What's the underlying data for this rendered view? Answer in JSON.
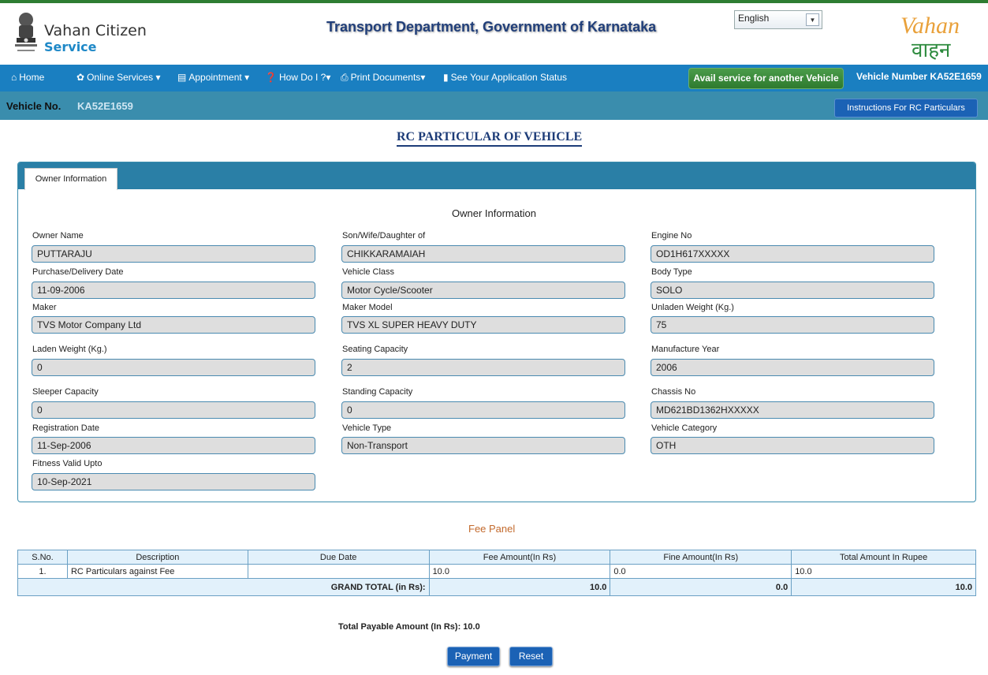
{
  "header": {
    "brand_line1": "Vahan Citizen",
    "brand_line2": "Service",
    "department_title": "Transport Department, Government of Karnataka",
    "language_selected": "English",
    "logo_text_latin": "Vahan",
    "logo_text_hindi": "वाहन"
  },
  "nav": {
    "home": "Home",
    "online_services": "Online Services",
    "appointment": "Appointment",
    "how_do_i": "How Do I ?",
    "print_documents": "Print Documents",
    "application_status": "See Your Application Status",
    "avail_service": "Avail service for another Vehicle",
    "vehicle_number_label": "Vehicle Number",
    "vehicle_number": "KA52E1659"
  },
  "vehicle_bar": {
    "label": "Vehicle No.",
    "value": "KA52E1659",
    "instructions_button": "Instructions For RC Particulars"
  },
  "page_heading": "RC PARTICULAR OF VEHICLE",
  "tabs": [
    "Owner Information"
  ],
  "owner_section_title": "Owner Information",
  "fields": {
    "owner_name": {
      "label": "Owner Name",
      "value": "PUTTARAJU"
    },
    "relation": {
      "label": "Son/Wife/Daughter of",
      "value": "CHIKKARAMAIAH"
    },
    "engine_no": {
      "label": "Engine No",
      "value": "OD1H617XXXXX"
    },
    "purchase_date": {
      "label": "Purchase/Delivery Date",
      "value": "11-09-2006"
    },
    "vehicle_class": {
      "label": "Vehicle Class",
      "value": "Motor Cycle/Scooter"
    },
    "body_type": {
      "label": "Body Type",
      "value": "SOLO"
    },
    "maker": {
      "label": "Maker",
      "value": "TVS Motor Company Ltd"
    },
    "maker_model": {
      "label": "Maker Model",
      "value": "TVS XL SUPER HEAVY DUTY"
    },
    "unladen_weight": {
      "label": "Unladen Weight (Kg.)",
      "value": "75"
    },
    "laden_weight": {
      "label": "Laden Weight (Kg.)",
      "value": "0"
    },
    "seating_capacity": {
      "label": "Seating Capacity",
      "value": "2"
    },
    "manufacture_year": {
      "label": "Manufacture Year",
      "value": "2006"
    },
    "sleeper_capacity": {
      "label": "Sleeper Capacity",
      "value": "0"
    },
    "standing_capacity": {
      "label": "Standing Capacity",
      "value": "0"
    },
    "chassis_no": {
      "label": "Chassis No",
      "value": "MD621BD1362HXXXXX"
    },
    "registration_date": {
      "label": "Registration Date",
      "value": "11-Sep-2006"
    },
    "vehicle_type": {
      "label": "Vehicle Type",
      "value": "Non-Transport"
    },
    "vehicle_category": {
      "label": "Vehicle Category",
      "value": "OTH"
    },
    "fitness_valid": {
      "label": "Fitness Valid Upto",
      "value": "10-Sep-2021"
    }
  },
  "fee_panel": {
    "title": "Fee Panel",
    "columns": [
      "S.No.",
      "Description",
      "Due Date",
      "Fee Amount(In Rs)",
      "Fine Amount(In Rs)",
      "Total Amount In Rupee"
    ],
    "rows": [
      {
        "sno": "1.",
        "description": "RC Particulars against Fee",
        "due_date": "",
        "fee": "10.0",
        "fine": "0.0",
        "total": "10.0"
      }
    ],
    "grand_total_label": "GRAND TOTAL (in Rs):",
    "grand_fee": "10.0",
    "grand_fine": "0.0",
    "grand_total": "10.0"
  },
  "payable_text": "Total Payable Amount (In Rs): 10.0",
  "buttons": {
    "payment": "Payment",
    "reset": "Reset"
  },
  "colors": {
    "nav_blue": "#1a7fc1",
    "vehicle_bar": "#3a8dad",
    "avail_green": "#2e7a2e",
    "button_blue": "#1b62b5",
    "fee_title": "#c36a2d"
  }
}
